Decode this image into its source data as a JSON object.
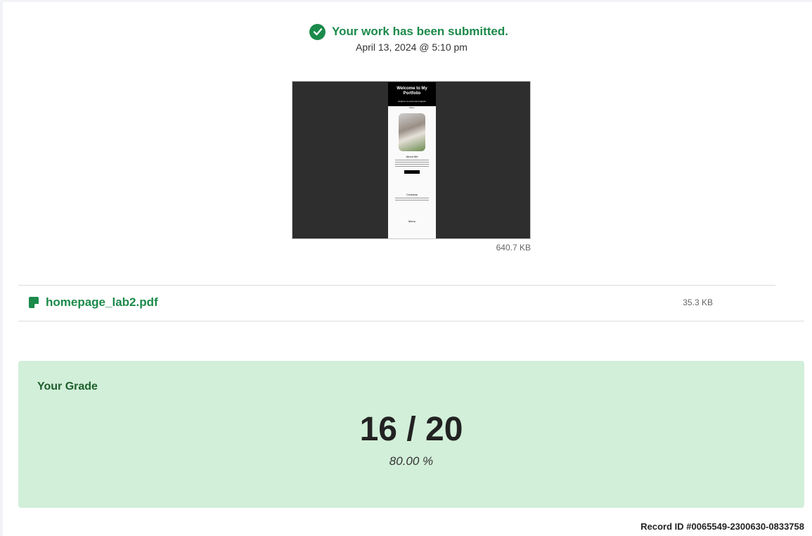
{
  "submission": {
    "status": "Your work has been submitted.",
    "timestamp": "April 13, 2024 @ 5:10 pm"
  },
  "preview": {
    "size": "640.7 KB",
    "thumbnail": {
      "title": "Welcome to My Portfolio",
      "subtitle": "Explore my work and projects",
      "nav": "Menu",
      "about_heading": "About Me",
      "button": "Contact Me",
      "contacts_heading": "Contacts",
      "menu_heading": "Menu"
    }
  },
  "attachment": {
    "icon": "file-icon",
    "name": "homepage_lab2.pdf",
    "size": "35.3 KB"
  },
  "grade": {
    "label": "Your Grade",
    "score": "16 / 20",
    "percent": "80.00 %"
  },
  "record_id": "Record ID #0065549-2300630-0833758",
  "colors": {
    "accent": "#1b8a4a",
    "grade_bg": "#d2efd9",
    "grade_title": "#1d5e2b"
  }
}
